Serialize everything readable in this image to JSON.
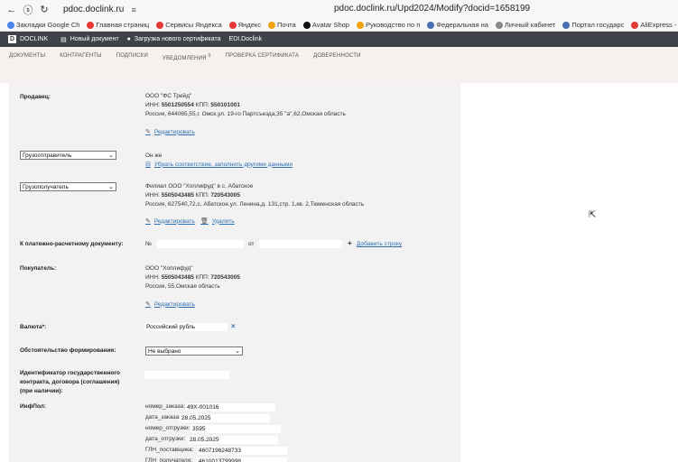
{
  "browser": {
    "url_short": "pdoc.doclink.ru",
    "url_full": "pdoc.doclink.ru/Upd2024/Modify?docid=1658199",
    "bookmarks": [
      {
        "label": "Закладки Google Ch",
        "color": "#4a86e8"
      },
      {
        "label": "Главная страниц",
        "color": "#e53935"
      },
      {
        "label": "Сервисы Яндекса",
        "color": "#e53935"
      },
      {
        "label": "Яндекс",
        "color": "#e53935"
      },
      {
        "label": "Почта",
        "color": "#f2a20c"
      },
      {
        "label": "Avatar Shop",
        "color": "#111111"
      },
      {
        "label": "Руководство по п",
        "color": "#f2a20c"
      },
      {
        "label": "Федеральная на",
        "color": "#4a6fb2"
      },
      {
        "label": "Личный кабинет",
        "color": "#888888"
      },
      {
        "label": "Портал государс",
        "color": "#4a6fb2"
      },
      {
        "label": "AliExpress - инте",
        "color": "#e53935"
      }
    ]
  },
  "app": {
    "logo_letter": "D",
    "logo_text": "DOCLINK",
    "links": [
      {
        "icon": "document-icon",
        "glyph": "▤",
        "label": "Новый документ"
      },
      {
        "icon": "dot-icon",
        "glyph": "●",
        "label": "Загрузка нового сертификата"
      },
      {
        "icon": "edi-icon",
        "glyph": "",
        "label": "EDI.Doclink"
      }
    ],
    "menu": [
      {
        "label": "ДОКУМЕНТЫ",
        "badge": ""
      },
      {
        "label": "КОНТРАГЕНТЫ",
        "badge": ""
      },
      {
        "label": "ПОДПИСКИ",
        "badge": ""
      },
      {
        "label": "УВЕДОМЛЕНИЯ",
        "badge": "0"
      },
      {
        "label": "ПРОВЕРКА СЕРТИФИКАТА",
        "badge": ""
      },
      {
        "label": "ДОВЕРЕННОСТИ",
        "badge": ""
      }
    ]
  },
  "form": {
    "seller": {
      "label": "Продавец:",
      "name": "ООО \"ФС Трейд\"",
      "inn_label": "ИНН:",
      "inn": "5501250554",
      "kpp_label": "КПП:",
      "kpp": "550101001",
      "address": "Россия, 644065,55,г. Омск,ул. 19-го Партсъезда,35 \"а\",62,Омская область",
      "edit": "Редактировать"
    },
    "shipper": {
      "select": "Грузоотправитель",
      "same": "Он же",
      "remove_link": "Убрать соответствие, заполнить другими данными"
    },
    "consignee": {
      "select": "Грузополучатель",
      "name": "Филиал ООО \"Хоплифуд\" в с. Абатское",
      "inn_label": "ИНН:",
      "inn": "5505043485",
      "kpp_label": "КПП:",
      "kpp": "720543005",
      "address": "Россия, 627540,72,с. Абатское,ул. Ленина,д. 131,стр. 1,кв. 2,Тюменская область",
      "edit": "Редактировать",
      "delete": "Удалить"
    },
    "payment_doc": {
      "label": "К платежно-расчетному документу:",
      "num_label": "№",
      "from_label": "от",
      "add_row": "Добавить строку"
    },
    "buyer": {
      "label": "Покупатель:",
      "name": "ООО \"Хоплифуд\"",
      "inn_label": "ИНН:",
      "inn": "5505043485",
      "kpp_label": "КПП:",
      "kpp": "720543005",
      "address": "Россия, 55,Омская область",
      "edit": "Редактировать"
    },
    "currency": {
      "label": "Валюта*:",
      "value": "Российский рубль"
    },
    "circumstance": {
      "label": "Обстоятельство формирования:",
      "value": "Не выбрано"
    },
    "contract_id": {
      "label_1": "Идентификатор государственного",
      "label_2": "контракта, договора (соглашения)",
      "label_3": "(при наличии):"
    },
    "infopol": {
      "label": "ИнфПол:",
      "rows": [
        {
          "key": "номер_заказа:",
          "value": "49Х-001016"
        },
        {
          "key": "дата_заказа:",
          "value": "28.05.2025"
        },
        {
          "key": "номер_отгрузки:",
          "value": "3595"
        },
        {
          "key": "дата_отгрузки:",
          "value": "28.05.2025"
        },
        {
          "key": "ГЛН_поставщика:",
          "value": "4607196248733"
        },
        {
          "key": "ГЛН_получателя:",
          "value": "4610013799998"
        }
      ]
    }
  }
}
